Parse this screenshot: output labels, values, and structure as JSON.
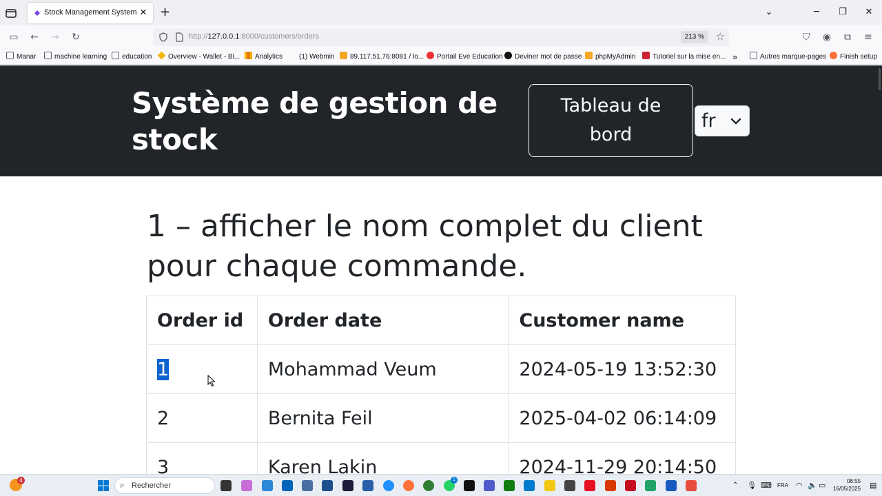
{
  "browser": {
    "tab_title": "Stock Management System",
    "url_prefix": "http://",
    "url_host": "127.0.0.1",
    "url_rest": ":8000/customers/orders",
    "zoom": "213 %"
  },
  "bookmarks": [
    "Manar",
    "machine learning",
    "education",
    "Overview - Wallet - Bi...",
    "Analytics",
    "(1) Webmin",
    "89.117.51.76:8081 / lo...",
    "Portail Eve Education",
    "Deviner mot de passe",
    "phpMyAdmin",
    "Tutoriel sur la mise en...",
    "Autres marque-pages",
    "Finish setup"
  ],
  "header": {
    "site_title": "Système de gestion de stock",
    "dashboard_label": "Tableau de bord",
    "language_value": "fr"
  },
  "main": {
    "heading": "1 – afficher le nom complet du client pour chaque commande.",
    "columns": [
      "Order id",
      "Order date",
      "Customer name"
    ],
    "rows": [
      [
        "1",
        "Mohammad Veum",
        "2024-05-19 13:52:30"
      ],
      [
        "2",
        "Bernita Feil",
        "2025-04-02 06:14:09"
      ],
      [
        "3",
        "Karen Lakin",
        "2024-11-29 20:14:50"
      ]
    ]
  },
  "taskbar": {
    "search_label": "Rechercher",
    "language": "FRA",
    "time": "08:55",
    "date": "16/05/2025",
    "notification_count": "4",
    "teams_badge": "1"
  },
  "colors": {
    "header_bg": "#212529",
    "selection": "#0b63ce",
    "text": "#212529"
  }
}
